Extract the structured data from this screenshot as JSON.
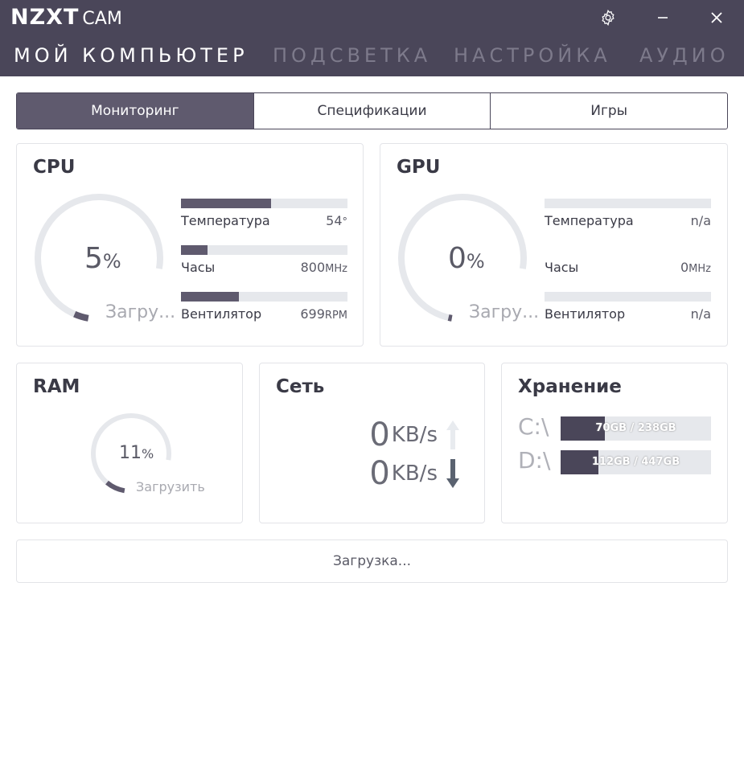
{
  "app": {
    "brand": "NZXT",
    "product": "CAM"
  },
  "window_controls": {
    "settings_icon": "gear-icon",
    "minimize_icon": "minimize-icon",
    "close_icon": "close-icon"
  },
  "nav": [
    "МОЙ КОМПЬЮТЕР",
    "ПОДСВЕТКА",
    "НАСТРОЙКА",
    "АУДИО"
  ],
  "tabs": [
    "Мониторинг",
    "Спецификации",
    "Игры"
  ],
  "cpu": {
    "title": "CPU",
    "load_value": "5",
    "load_unit": "%",
    "load_label": "Загру...",
    "load_fraction": 0.05,
    "stats": [
      {
        "label": "Температура",
        "value": "54",
        "unit": "°",
        "fraction": 0.54
      },
      {
        "label": "Часы",
        "value": "800",
        "unit": "MHz",
        "fraction": 0.16
      },
      {
        "label": "Вентилятор",
        "value": "699",
        "unit": "RPM",
        "fraction": 0.35
      }
    ]
  },
  "gpu": {
    "title": "GPU",
    "load_value": "0",
    "load_unit": "%",
    "load_label": "Загру...",
    "load_fraction": 0.0,
    "stats": [
      {
        "label": "Температура",
        "value": "n/a",
        "unit": "",
        "fraction": 0
      },
      {
        "label": "Часы",
        "value": "0",
        "unit": "MHz",
        "fraction": null
      },
      {
        "label": "Вентилятор",
        "value": "n/a",
        "unit": "",
        "fraction": 0
      }
    ]
  },
  "ram": {
    "title": "RAM",
    "load_value": "11",
    "load_unit": "%",
    "load_label": "Загрузить",
    "load_fraction": 0.11
  },
  "network": {
    "title": "Сеть",
    "upload": {
      "value": "0",
      "unit": "KB/s",
      "icon": "arrow-up-icon"
    },
    "download": {
      "value": "0",
      "unit": "KB/s",
      "icon": "arrow-down-icon"
    }
  },
  "storage": {
    "title": "Хранение",
    "drives": [
      {
        "letter": "C:\\",
        "text": "70GB / 238GB",
        "fraction": 0.294
      },
      {
        "letter": "D:\\",
        "text": "112GB / 447GB",
        "fraction": 0.251
      }
    ]
  },
  "status": {
    "loading_text": "Загрузка..."
  },
  "colors": {
    "header": "#4a4659",
    "accent": "#5f5a6e",
    "track": "#e6e8ec"
  }
}
